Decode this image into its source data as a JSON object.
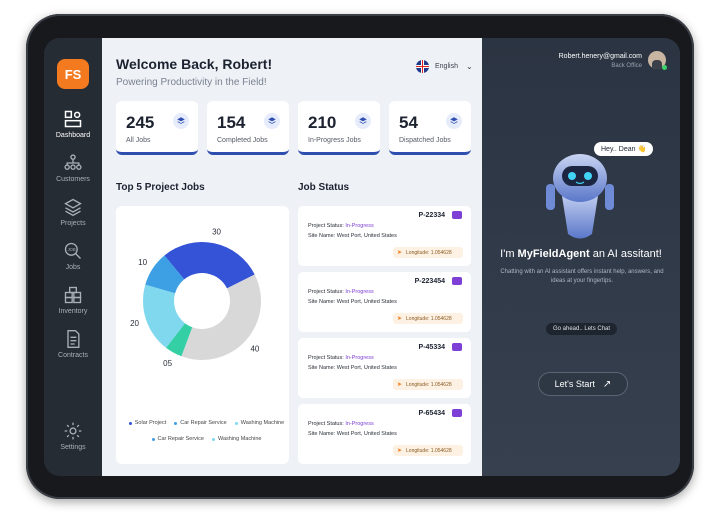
{
  "sidebar": {
    "logo": "FS",
    "items": [
      {
        "label": "Dashboard"
      },
      {
        "label": "Customers"
      },
      {
        "label": "Projects"
      },
      {
        "label": "Jobs"
      },
      {
        "label": "Inventory"
      },
      {
        "label": "Contracts"
      },
      {
        "label": "Settings"
      }
    ]
  },
  "header": {
    "welcome": "Welcome Back, Robert!",
    "subtitle": "Powering Productivity in the Field!",
    "language": "English"
  },
  "stats": [
    {
      "value": "245",
      "label": "All Jobs"
    },
    {
      "value": "154",
      "label": "Completed Jobs"
    },
    {
      "value": "210",
      "label": "In-Progress Jobs"
    },
    {
      "value": "54",
      "label": "Dispatched Jobs"
    }
  ],
  "sections": {
    "top_projects": "Top 5 Project Jobs",
    "job_status": "Job Status"
  },
  "chart_data": {
    "type": "pie",
    "categories": [
      "Solar Project",
      "Car Repair Service",
      "Washing Machine",
      "Car Repair Service",
      "Washing Machine"
    ],
    "values": [
      30,
      40,
      5,
      20,
      10
    ],
    "value_labels": [
      "30",
      "40",
      "05",
      "20",
      "10"
    ],
    "colors": [
      "#3553d6",
      "#d8d8d8",
      "#35cfa6",
      "#7fd8ee",
      "#3ea0e4"
    ],
    "legend": [
      {
        "name": "Solar Project",
        "color": "#3553d6"
      },
      {
        "name": "Car Repair Service",
        "color": "#3ea0e4"
      },
      {
        "name": "Washing Machine",
        "color": "#7fd8ee"
      },
      {
        "name": "Car Repair Service",
        "color": "#3ea0e4"
      },
      {
        "name": "Washing Machine",
        "color": "#7fd8ee"
      }
    ]
  },
  "jobs": [
    {
      "id": "P-22334",
      "status_label": "Project Status:",
      "status": "In-Progress",
      "site_label": "Site Name:",
      "site": "West Port, United States",
      "longitude": "Longitude: 1.054628"
    },
    {
      "id": "P-223454",
      "status_label": "Project Status:",
      "status": "In-Progress",
      "site_label": "Site Name:",
      "site": "West Port, United States",
      "longitude": "Longitude: 1.054628"
    },
    {
      "id": "P-45334",
      "status_label": "Project Status:",
      "status": "In-Progress",
      "site_label": "Site Name:",
      "site": "West Port, United States",
      "longitude": "Longitude: 1.054628"
    },
    {
      "id": "P-65434",
      "status_label": "Project Status:",
      "status": "In-Progress",
      "site_label": "Site Name:",
      "site": "West Port, United States",
      "longitude": "Longitude: 1.054628"
    }
  ],
  "assistant": {
    "email": "Robert.henery@gmail.com",
    "role": "Back Office",
    "greeting": "Hey.. Dean 👋",
    "tagline_prefix": "I'm ",
    "tagline_brand": "MyFieldAgent",
    "tagline_suffix": " an AI assitant!",
    "description": "Chatting with an AI assistant offers instant help, answers, and ideas at your fingertips.",
    "prompt": "Go ahead.. Lets Chat",
    "start_label": "Let's Start",
    "start_icon": "↗"
  },
  "colors": {
    "accent": "#f47a20",
    "primary": "#2f4fb0",
    "status": "#7d3fd6"
  }
}
